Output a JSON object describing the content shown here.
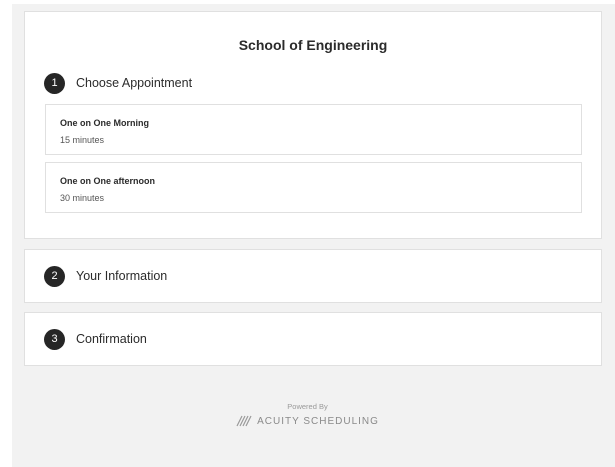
{
  "business": {
    "title": "School of Engineering"
  },
  "steps": [
    {
      "number": "1",
      "label": "Choose Appointment"
    },
    {
      "number": "2",
      "label": "Your Information"
    },
    {
      "number": "3",
      "label": "Confirmation"
    }
  ],
  "appointments": [
    {
      "name": "One on One Morning",
      "duration": "15 minutes"
    },
    {
      "name": "One on One afternoon",
      "duration": "30 minutes"
    }
  ],
  "footer": {
    "powered_by": "Powered By",
    "brand": "ACUITY SCHEDULING",
    "logo_icon": "acuity-logo-icon"
  },
  "colors": {
    "step_badge": "#262626",
    "page_background": "#f2f2f2",
    "card_border": "#e0e0e0"
  }
}
